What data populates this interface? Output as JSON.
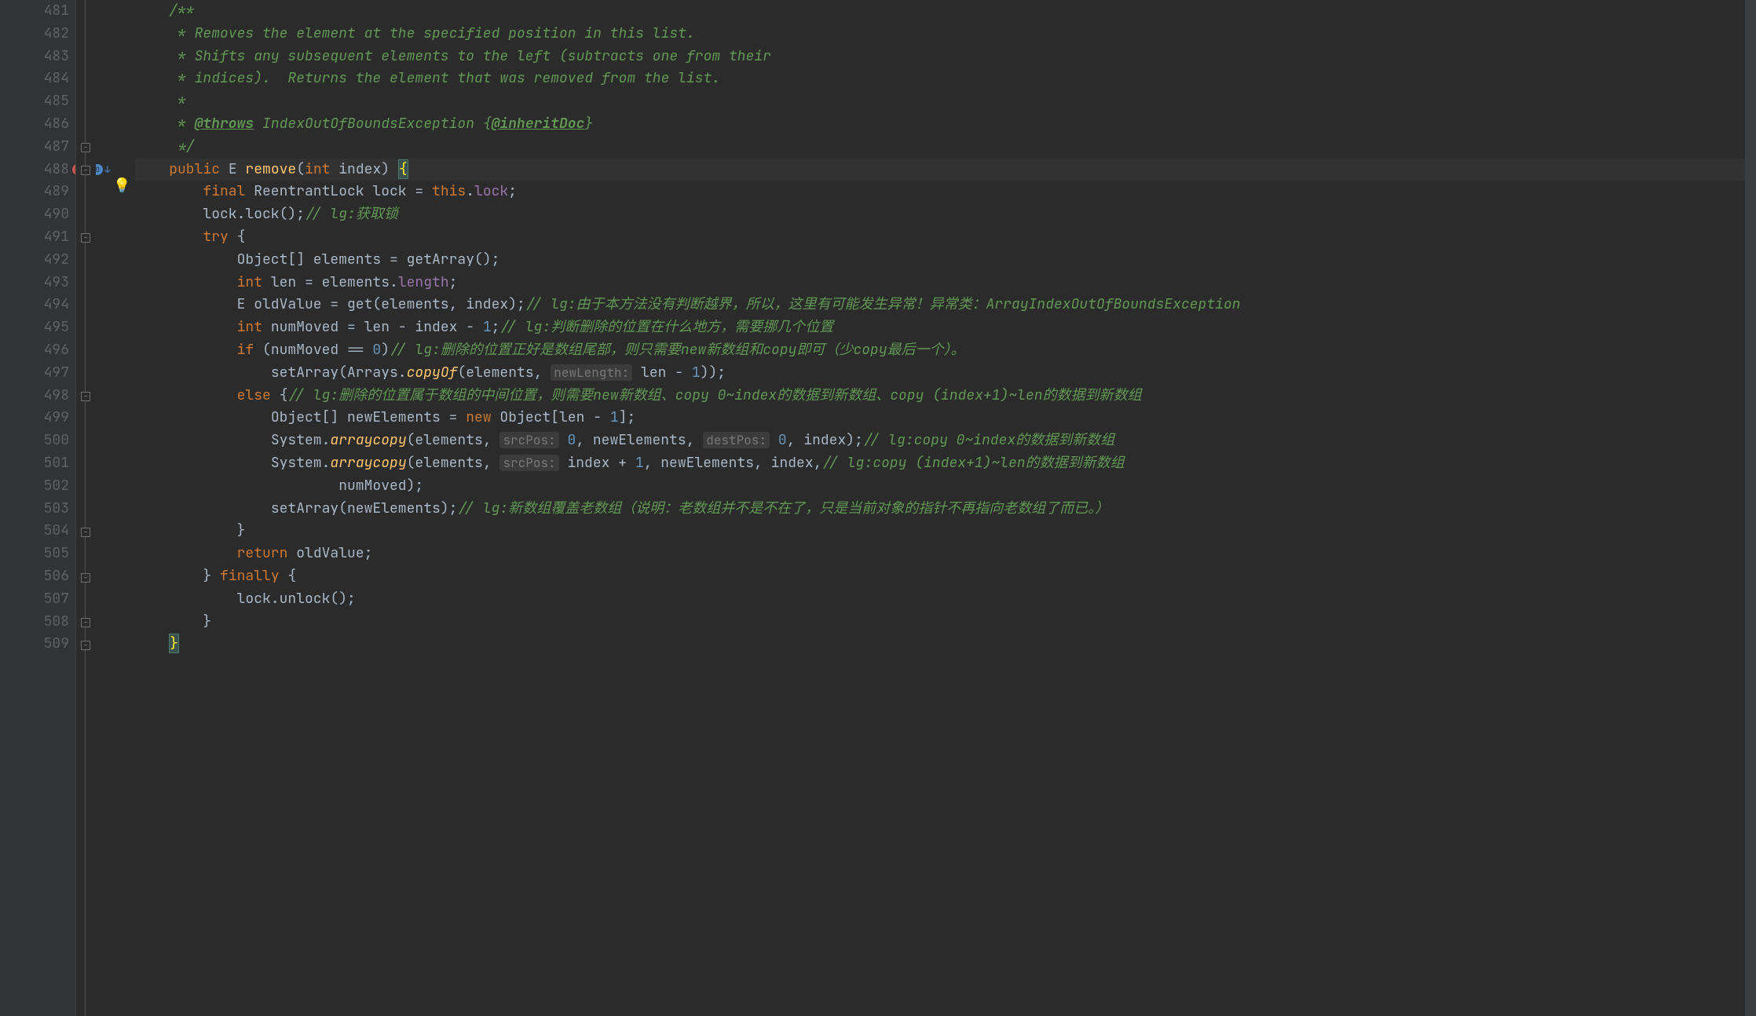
{
  "lines": {
    "start": 481,
    "end": 509,
    "current": 488
  },
  "code": {
    "l481": "/**",
    "l482": " * Removes the element at the specified position in this list.",
    "l483": " * Shifts any subsequent elements to the left (subtracts one from their",
    "l484": " * indices).  Returns the element that was removed from the list.",
    "l485": " *",
    "l486_prefix": " * ",
    "l486_throws": "@throws",
    "l486_mid": " IndexOutOfBoundsException {",
    "l486_inherit": "@inheritDoc",
    "l486_end": "}",
    "l487": " */",
    "l488_public": "public",
    "l488_e": " E ",
    "l488_remove": "remove",
    "l488_lp": "(",
    "l488_int": "int",
    "l488_index": " index",
    "l488_rp": ") ",
    "l488_brace": "{",
    "l489_final": "final",
    "l489_type": " ReentrantLock lock = ",
    "l489_this": "this",
    "l489_dot": ".",
    "l489_field": "lock",
    "l489_semi": ";",
    "l490_call": "lock.lock();",
    "l490_comment": "// lg:获取锁",
    "l491_try": "try",
    "l491_brace": " {",
    "l492": "Object[] elements = getArray();",
    "l493_int": "int",
    "l493_mid": " len = elements.",
    "l493_field": "length",
    "l493_semi": ";",
    "l494_pre": "E oldValue = get(elements, index);",
    "l494_comment": "// lg:由于本方法没有判断越界，所以，这里有可能发生异常！异常类：ArrayIndexOutOfBoundsException",
    "l495_int": "int",
    "l495_mid": " numMoved = len - index - ",
    "l495_num": "1",
    "l495_semi": ";",
    "l495_comment": "// lg:判断删除的位置在什么地方，需要挪几个位置",
    "l496_if": "if",
    "l496_cond": " (numMoved == ",
    "l496_zero": "0",
    "l496_rp": ")",
    "l496_comment": "// lg:删除的位置正好是数组尾部，则只需要new新数组和copy即可（少copy最后一个）。",
    "l497_call": "setArray(Arrays.",
    "l497_copyof": "copyOf",
    "l497_args": "(elements, ",
    "l497_hint": "newLength:",
    "l497_rest": " len - ",
    "l497_one": "1",
    "l497_end": "));",
    "l498_else": "else",
    "l498_brace": " {",
    "l498_comment": "// lg:删除的位置属于数组的中间位置，则需要new新数组、copy 0~index的数据到新数组、copy (index+1)~len的数据到新数组",
    "l499_pre": "Object[] newElements = ",
    "l499_new": "new",
    "l499_post": " Object[len - ",
    "l499_one": "1",
    "l499_end": "];",
    "l500_sys": "System.",
    "l500_method": "arraycopy",
    "l500_lp": "(elements, ",
    "l500_hint1": "srcPos:",
    "l500_zero1": " 0",
    "l500_mid": ", newElements, ",
    "l500_hint2": "destPos:",
    "l500_zero2": " 0",
    "l500_end": ", index);",
    "l500_comment": "// lg:copy 0~index的数据到新数组",
    "l501_sys": "System.",
    "l501_method": "arraycopy",
    "l501_lp": "(elements, ",
    "l501_hint": "srcPos:",
    "l501_mid": " index + ",
    "l501_one": "1",
    "l501_rest": ", newElements, index,",
    "l501_comment": "// lg:copy (index+1)~len的数据到新数组",
    "l502": "numMoved);",
    "l503_call": "setArray(newElements);",
    "l503_comment": "// lg:新数组覆盖老数组（说明：老数组并不是不在了，只是当前对象的指针不再指向老数组了而已。）",
    "l504": "}",
    "l505_return": "return",
    "l505_val": " oldValue;",
    "l506_brace": "} ",
    "l506_finally": "finally",
    "l506_open": " {",
    "l507": "lock.unlock();",
    "l508": "}",
    "l509": "}"
  },
  "hints": {
    "newLength": "newLength:",
    "srcPos": "srcPos:",
    "destPos": "destPos:"
  }
}
